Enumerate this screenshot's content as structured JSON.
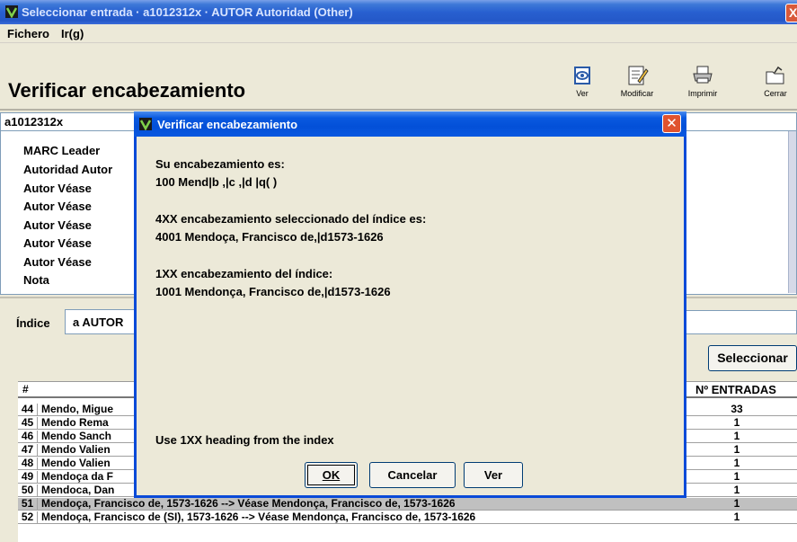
{
  "window": {
    "title": "Seleccionar entrada · a1012312x · AUTOR Autoridad (Other)",
    "close_glyph": "X"
  },
  "menu": {
    "fichero": "Fichero",
    "ir": "Ir(g)"
  },
  "header": {
    "title": "Verificar encabezamiento",
    "toolbar": [
      {
        "label": "Ver",
        "icon": "eye-icon"
      },
      {
        "label": "Modificar",
        "icon": "edit-icon"
      },
      {
        "label": "Imprimir",
        "icon": "printer-icon"
      },
      {
        "label": "Cerrar",
        "icon": "close-folder-icon"
      }
    ]
  },
  "record": {
    "id": "a1012312x",
    "fields": [
      "MARC Leader",
      "Autoridad Autor",
      "Autor Véase",
      "Autor Véase",
      "Autor Véase",
      "Autor Véase",
      "Autor Véase",
      "Nota"
    ]
  },
  "index": {
    "label": "Índice",
    "value": "a AUTOR"
  },
  "select_button": "Seleccionar",
  "table": {
    "headers": {
      "num": "#",
      "entries": "Nº ENTRADAS"
    },
    "rows": [
      {
        "num": "44",
        "text": "Mendo, Migue",
        "count": "33"
      },
      {
        "num": "45",
        "text": "Mendo Rema",
        "count": "1"
      },
      {
        "num": "46",
        "text": "Mendo Sanch",
        "count": "1"
      },
      {
        "num": "47",
        "text": "Mendo Valien",
        "count": "1"
      },
      {
        "num": "48",
        "text": "Mendo Valien",
        "count": "1"
      },
      {
        "num": "49",
        "text": "Mendoça da F",
        "count": "1"
      },
      {
        "num": "50",
        "text": "Mendoca, Dan",
        "count": "1"
      },
      {
        "num": "51",
        "text": "Mendoça, Francisco de, 1573-1626 --> Véase Mendonça, Francisco de, 1573-1626",
        "count": "1"
      },
      {
        "num": "52",
        "text": "Mendoça, Francisco de (SI), 1573-1626 --> Véase Mendonça, Francisco de, 1573-1626",
        "count": "1"
      }
    ]
  },
  "dialog": {
    "title": "Verificar encabezamiento",
    "close_glyph": "✕",
    "line1": "Su encabezamiento es:",
    "line2": "100   Mend|b ,|c ,|d |q( )",
    "line3": "4XX encabezamiento seleccionado del índice es:",
    "line4": "4001  Mendoça, Francisco de,|d1573-1626",
    "line5": "1XX encabezamiento del índice:",
    "line6": "1001  Mendonça, Francisco de,|d1573-1626",
    "note": "Use 1XX heading from the index",
    "buttons": {
      "ok": "OK",
      "cancel": "Cancelar",
      "ver": "Ver"
    }
  }
}
